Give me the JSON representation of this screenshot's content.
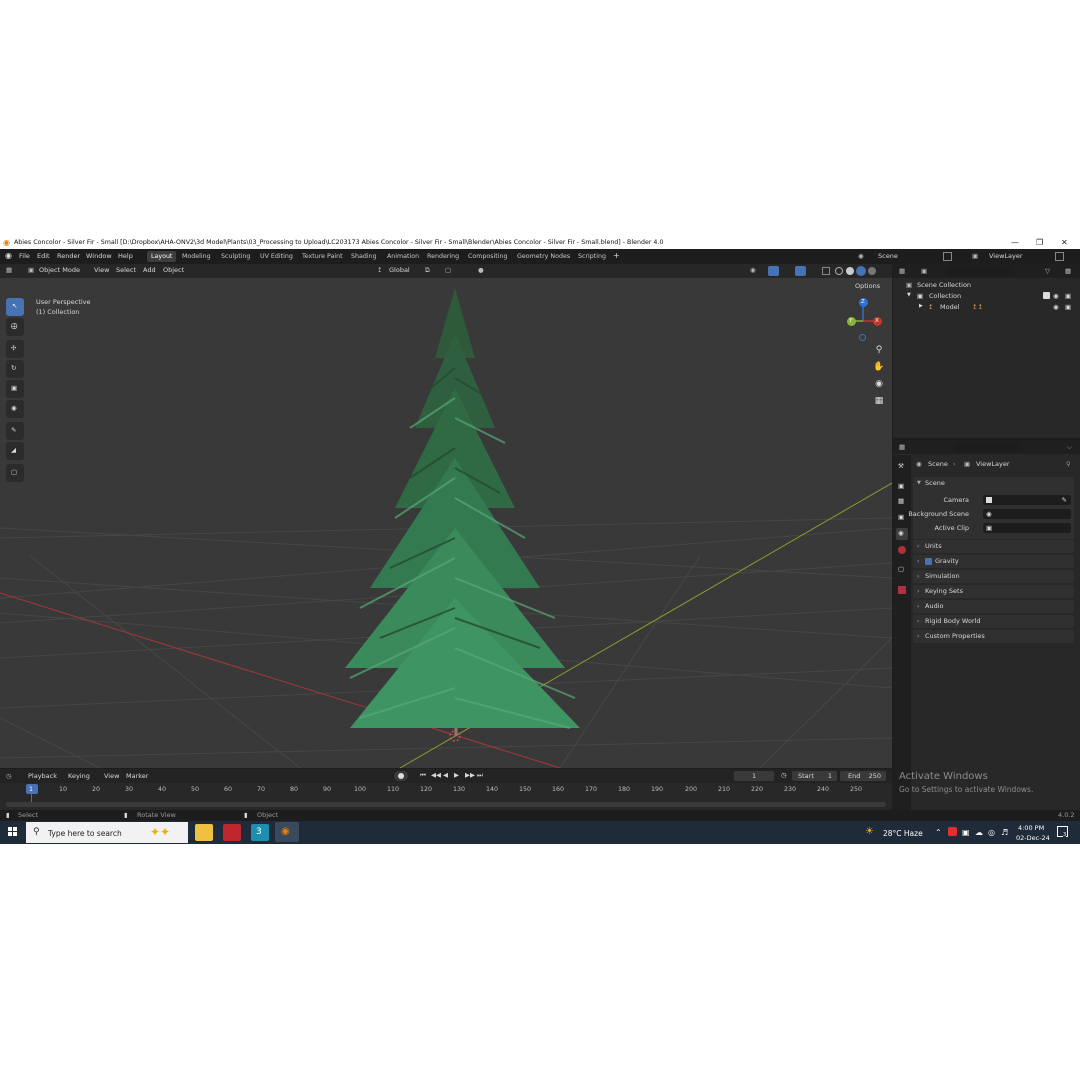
{
  "window": {
    "title": "Abies Concolor - Silver Fir - Small [D:\\Dropbox\\AHA-ONV2\\3d Model\\Plants\\03_Processing to Upload\\LC203173 Abies Concolor - Silver Fir - Small\\Blender\\Abies Concolor - Silver Fir - Small.blend] - Blender 4.0",
    "minimize": "—",
    "maximize": "❐",
    "close": "✕"
  },
  "menu": {
    "items": [
      "File",
      "Edit",
      "Render",
      "Window",
      "Help"
    ]
  },
  "workspaces": {
    "tabs": [
      "Layout",
      "Modeling",
      "Sculpting",
      "UV Editing",
      "Texture Paint",
      "Shading",
      "Animation",
      "Rendering",
      "Compositing",
      "Geometry Nodes",
      "Scripting"
    ],
    "active": "Layout",
    "add": "+"
  },
  "scene_selector": {
    "scene": "Scene",
    "view_layer": "ViewLayer"
  },
  "viewport_header": {
    "mode": "Object Mode",
    "items": [
      "View",
      "Select",
      "Add",
      "Object"
    ],
    "orientation": "Global",
    "options": "Options"
  },
  "viewport": {
    "overlay_line1": "User Perspective",
    "overlay_line2": "(1) Collection",
    "gizmo": {
      "z": "Z",
      "y": "Y",
      "x": "X"
    },
    "watermark_title": "Activate Windows",
    "watermark_sub": "Go to Settings to activate Windows."
  },
  "outliner": {
    "root": "Scene Collection",
    "collection": "Collection",
    "object": "Model"
  },
  "properties": {
    "breadcrumb_scene": "Scene",
    "breadcrumb_layer": "ViewLayer",
    "scene_panel": "Scene",
    "fields": [
      {
        "label": "Camera",
        "value": ""
      },
      {
        "label": "Background Scene",
        "value": ""
      },
      {
        "label": "Active Clip",
        "value": ""
      }
    ],
    "panels": [
      "Units",
      "Gravity",
      "Simulation",
      "Keying Sets",
      "Audio",
      "Rigid Body World",
      "Custom Properties"
    ]
  },
  "timeline": {
    "menus": [
      "Playback",
      "Keying",
      "View",
      "Marker"
    ],
    "current_frame": "1",
    "start_label": "Start",
    "start": "1",
    "end_label": "End",
    "end": "250",
    "ticks": [
      "1",
      "10",
      "20",
      "30",
      "40",
      "50",
      "60",
      "70",
      "80",
      "90",
      "100",
      "110",
      "120",
      "130",
      "140",
      "150",
      "160",
      "170",
      "180",
      "190",
      "200",
      "210",
      "220",
      "230",
      "240",
      "250"
    ]
  },
  "statusbar": {
    "select": "Select",
    "rotate": "Rotate View",
    "object": "Object",
    "version": "4.0.2"
  },
  "taskbar": {
    "search_placeholder": "Type here to search",
    "weather": "28°C  Haze",
    "time": "4:00 PM",
    "date": "02-Dec-24",
    "notifications": "3"
  },
  "colors": {
    "accent": "#4772b3",
    "tree": "#2e7d4f",
    "x_axis": "#c0392b",
    "y_axis": "#8ab33a",
    "z_axis": "#2f6fd1"
  }
}
